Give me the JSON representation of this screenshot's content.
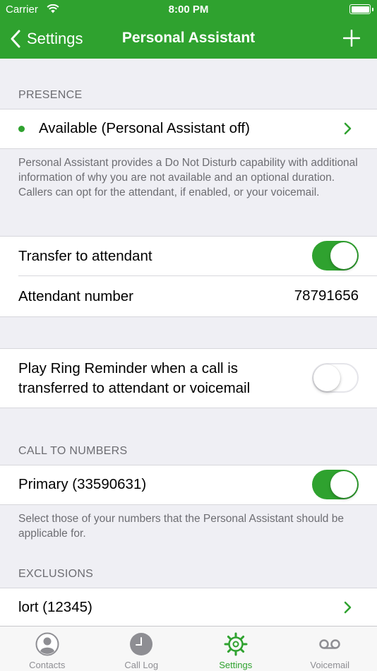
{
  "status_bar": {
    "carrier": "Carrier",
    "time": "8:00 PM"
  },
  "nav": {
    "back_label": "Settings",
    "title": "Personal Assistant",
    "add_icon": "plus-icon"
  },
  "presence": {
    "header": "PRESENCE",
    "status_label": "Available (Personal Assistant off)",
    "status_color": "#2fa22f",
    "footnote": "Personal Assistant provides a Do Not Disturb capability with additional information of why you are not available and an optional duration. Callers can opt for the attendant, if enabled, or your voicemail."
  },
  "attendant": {
    "transfer_label": "Transfer to attendant",
    "transfer_on": true,
    "number_label": "Attendant number",
    "number_value": "78791656"
  },
  "ring_reminder": {
    "line1": "Play Ring Reminder when a call is",
    "line2": "transferred to attendant or voicemail",
    "enabled": false
  },
  "call_to_numbers": {
    "header": "CALL TO NUMBERS",
    "primary_label": "Primary (33590631)",
    "primary_on": true,
    "footnote": "Select those of your numbers that the Personal Assistant should be applicable for."
  },
  "exclusions": {
    "header": "EXCLUSIONS",
    "items": [
      {
        "label": "lort (12345)"
      }
    ]
  },
  "tabbar": {
    "tabs": [
      {
        "label": "Contacts",
        "icon": "contacts-icon",
        "active": false
      },
      {
        "label": "Call Log",
        "icon": "clock-icon",
        "active": false
      },
      {
        "label": "Settings",
        "icon": "gear-icon",
        "active": true
      },
      {
        "label": "Voicemail",
        "icon": "voicemail-icon",
        "active": false
      }
    ]
  },
  "colors": {
    "accent": "#2fa22f",
    "background": "#efeff4",
    "secondary_text": "#6d6d72",
    "tab_inactive": "#8e8e93"
  }
}
